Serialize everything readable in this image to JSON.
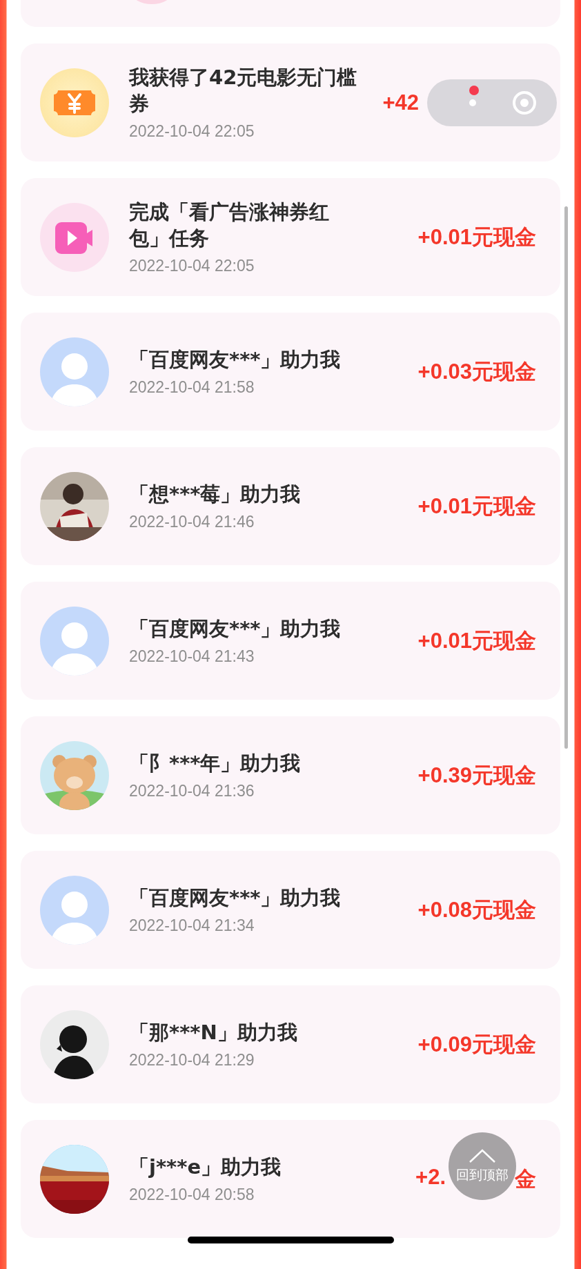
{
  "records": [
    {
      "kind": "ticket",
      "title": "我获得了42元电影无门槛券",
      "time": "2022-10-04 22:05",
      "amount": "+42"
    },
    {
      "kind": "video",
      "title": "完成「看广告涨神券红包」任务",
      "time": "2022-10-04 22:05",
      "amount": "+0.01元现金"
    },
    {
      "kind": "default",
      "title": "「百度网友***」助力我",
      "time": "2022-10-04 21:58",
      "amount": "+0.03元现金"
    },
    {
      "kind": "photo-person",
      "title": "「想***莓」助力我",
      "time": "2022-10-04 21:46",
      "amount": "+0.01元现金"
    },
    {
      "kind": "default",
      "title": "「百度网友***」助力我",
      "time": "2022-10-04 21:43",
      "amount": "+0.01元现金"
    },
    {
      "kind": "bear",
      "title": "「阝***年」助力我",
      "time": "2022-10-04 21:36",
      "amount": "+0.39元现金"
    },
    {
      "kind": "default",
      "title": "「百度网友***」助力我",
      "time": "2022-10-04 21:34",
      "amount": "+0.08元现金"
    },
    {
      "kind": "silhouette",
      "title": "「那***N」助力我",
      "time": "2022-10-04 21:29",
      "amount": "+0.09元现金"
    },
    {
      "kind": "wall",
      "title": "「j***e」助力我",
      "time": "2022-10-04 20:58",
      "amount": "+2.",
      "amount_tail": "金"
    }
  ],
  "scroll_top_button": {
    "label": "回到顶部"
  }
}
